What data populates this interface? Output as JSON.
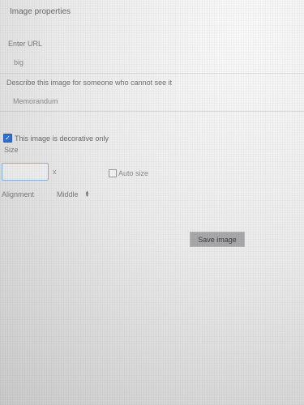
{
  "dialog": {
    "title": "Image properties"
  },
  "url": {
    "label": "Enter URL",
    "value": "big"
  },
  "description": {
    "label": "Describe this image for someone who cannot see it",
    "value": "Memorandum"
  },
  "decorative": {
    "label": "This image is decorative only",
    "checked": true,
    "check_glyph": "✓"
  },
  "size": {
    "label": "Size",
    "width_value": "",
    "separator": "x",
    "auto_label": "Auto size",
    "auto_checked": false
  },
  "alignment": {
    "label": "Alignment",
    "selected": "Middle"
  },
  "actions": {
    "save_label": "Save image"
  },
  "colors": {
    "checkbox_accent": "#2f6fd6",
    "save_button_bg": "#a9a9ab",
    "input_focus_border": "#8fb0d8"
  }
}
